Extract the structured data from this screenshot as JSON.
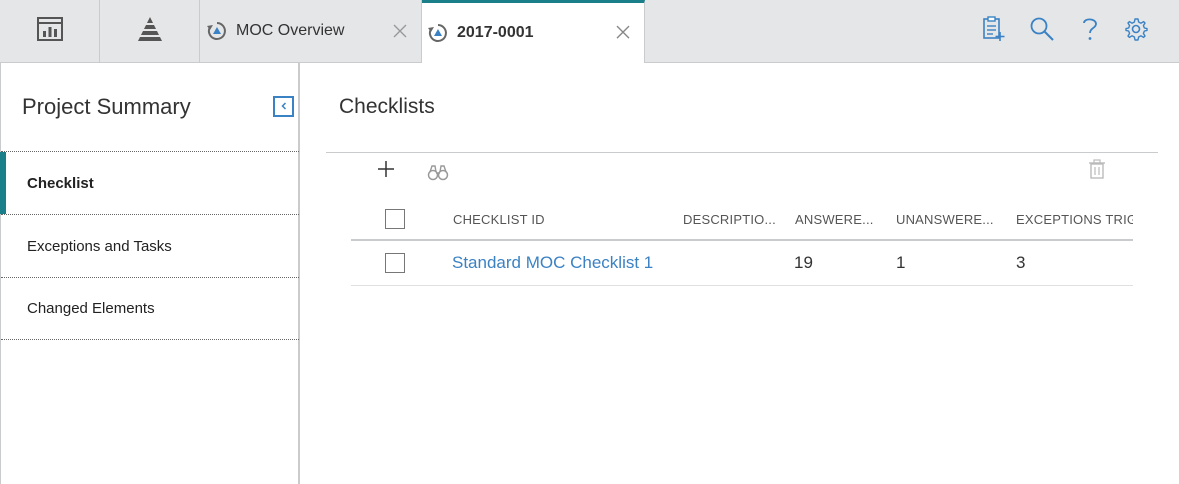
{
  "tabs": {
    "home_icon": "dashboard-icon",
    "hierarchy_icon": "pyramid-icon",
    "items": [
      {
        "label": "MOC Overview",
        "icon": "moc-icon",
        "active": false
      },
      {
        "label": "2017-0001",
        "icon": "moc-icon",
        "active": true
      }
    ]
  },
  "toolbar": {
    "icons": [
      "new-record-icon",
      "search-icon",
      "help-icon",
      "settings-icon"
    ]
  },
  "sidebar": {
    "title": "Project Summary",
    "items": [
      {
        "label": "Checklist",
        "active": true
      },
      {
        "label": "Exceptions and Tasks",
        "active": false
      },
      {
        "label": "Changed Elements",
        "active": false
      }
    ]
  },
  "main": {
    "title": "Checklists",
    "grid": {
      "columns": [
        "CHECKLIST ID",
        "DESCRIPTIO...",
        "ANSWERE...",
        "UNANSWERE...",
        "EXCEPTIONS TRIGG"
      ],
      "rows": [
        {
          "checklist_id": "Standard MOC Checklist 1",
          "description": "",
          "answered": "19",
          "unanswered": "1",
          "exceptions": "3"
        }
      ]
    }
  },
  "colors": {
    "accent": "#1b7f8a",
    "link": "#3b82c4",
    "topbar_bg": "#e4e6e8"
  }
}
